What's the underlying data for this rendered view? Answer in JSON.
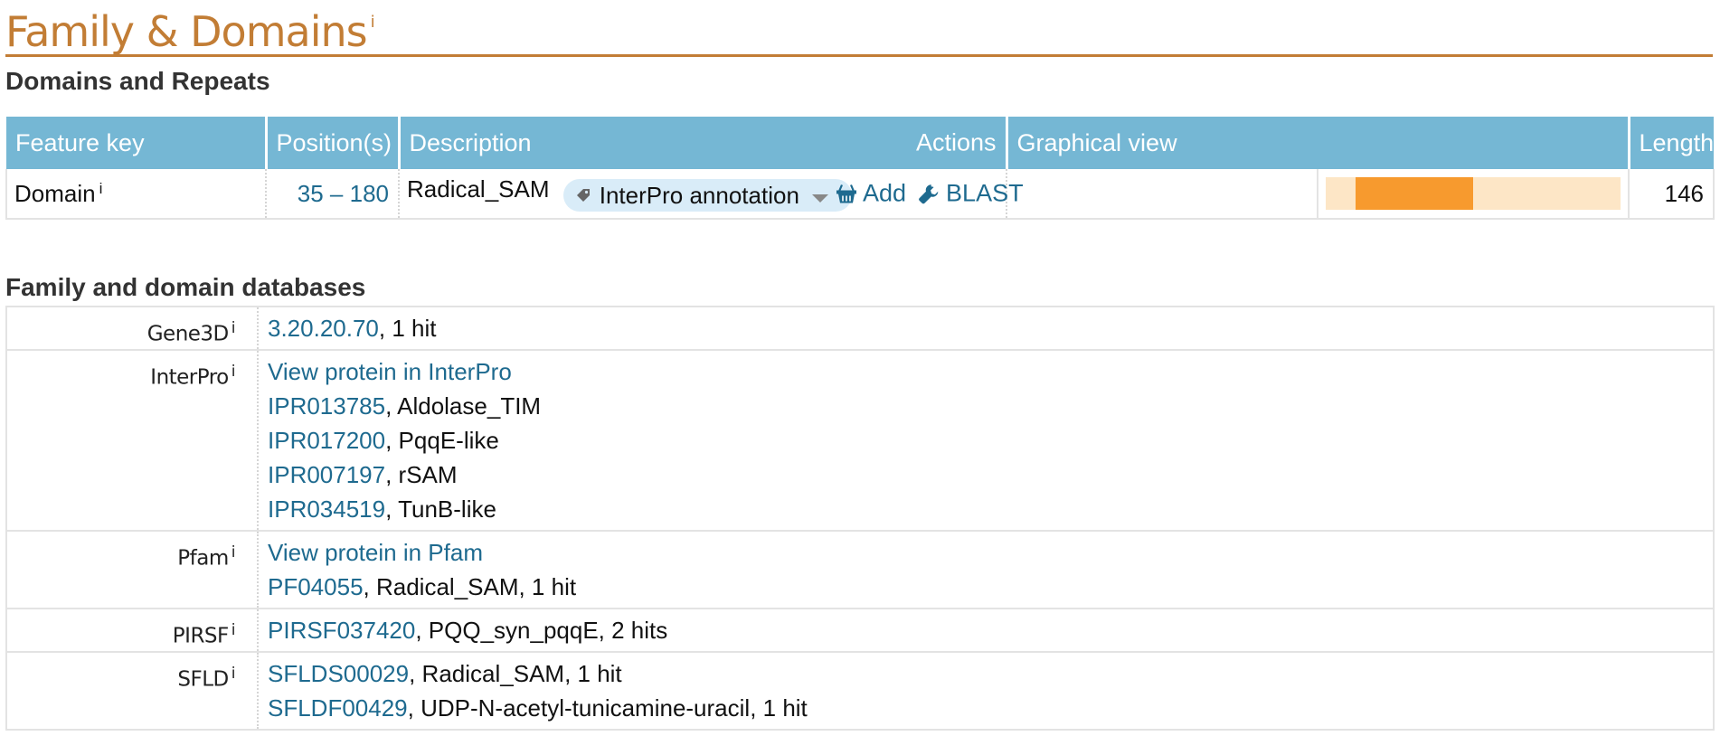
{
  "section": {
    "title": "Family & Domains",
    "info": "i"
  },
  "domains": {
    "heading": "Domains and Repeats",
    "headers": {
      "feature_key": "Feature key",
      "positions": "Position(s)",
      "description": "Description",
      "actions": "Actions",
      "graphical": "Graphical view",
      "length": "Length"
    },
    "row": {
      "feature": "Domain",
      "info": "i",
      "position": "35 – 180",
      "description": "Radical_SAM",
      "pill_label": "InterPro annotation",
      "add_label": "Add",
      "blast_label": "BLAST",
      "length": "146",
      "graph": {
        "start_fraction": 0.1,
        "end_fraction": 0.5
      }
    }
  },
  "families": {
    "heading": "Family and domain databases",
    "rows": [
      {
        "db": "Gene3D",
        "info": "i",
        "lines": [
          {
            "link": "3.20.20.70",
            "rest": ", 1 hit"
          }
        ]
      },
      {
        "db": "InterPro",
        "info": "i",
        "lines": [
          {
            "link": "View protein in InterPro",
            "rest": ""
          },
          {
            "link": "IPR013785",
            "rest": ", Aldolase_TIM"
          },
          {
            "link": "IPR017200",
            "rest": ", PqqE-like"
          },
          {
            "link": "IPR007197",
            "rest": ", rSAM"
          },
          {
            "link": "IPR034519",
            "rest": ", TunB-like"
          }
        ]
      },
      {
        "db": "Pfam",
        "info": "i",
        "lines": [
          {
            "link": "View protein in Pfam",
            "rest": ""
          },
          {
            "link": "PF04055",
            "rest": ", Radical_SAM, 1 hit"
          }
        ]
      },
      {
        "db": "PIRSF",
        "info": "i",
        "lines": [
          {
            "link": "PIRSF037420",
            "rest": ", PQQ_syn_pqqE, 2 hits"
          }
        ]
      },
      {
        "db": "SFLD",
        "info": "i",
        "lines": [
          {
            "link": "SFLDS00029",
            "rest": ", Radical_SAM, 1 hit"
          },
          {
            "link": "SFLDF00429",
            "rest": ", UDP-N-acetyl-tunicamine-uracil, 1 hit"
          }
        ]
      }
    ]
  },
  "colors": {
    "accent": "#c27d35",
    "header_bg": "#75b7d4",
    "link": "#1e6a8f",
    "bar": "#f79a2e",
    "track": "#fde6c6"
  }
}
